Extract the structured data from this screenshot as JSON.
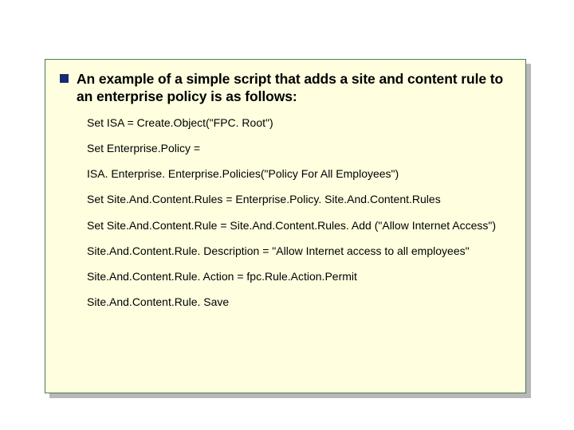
{
  "heading": "An example of a simple script that adds a site and content rule to an enterprise policy is as follows:",
  "lines": [
    "Set ISA = Create.Object(\"FPC. Root\")",
    "Set Enterprise.Policy =",
    "ISA. Enterprise. Enterprise.Policies(\"Policy For All Employees\")",
    "Set Site.And.Content.Rules = Enterprise.Policy. Site.And.Content.Rules",
    "Set Site.And.Content.Rule = Site.And.Content.Rules. Add (\"Allow Internet Access\")",
    "Site.And.Content.Rule. Description = \"Allow Internet access to all employees\"",
    "Site.And.Content.Rule. Action = fpc.Rule.Action.Permit",
    "Site.And.Content.Rule. Save"
  ]
}
